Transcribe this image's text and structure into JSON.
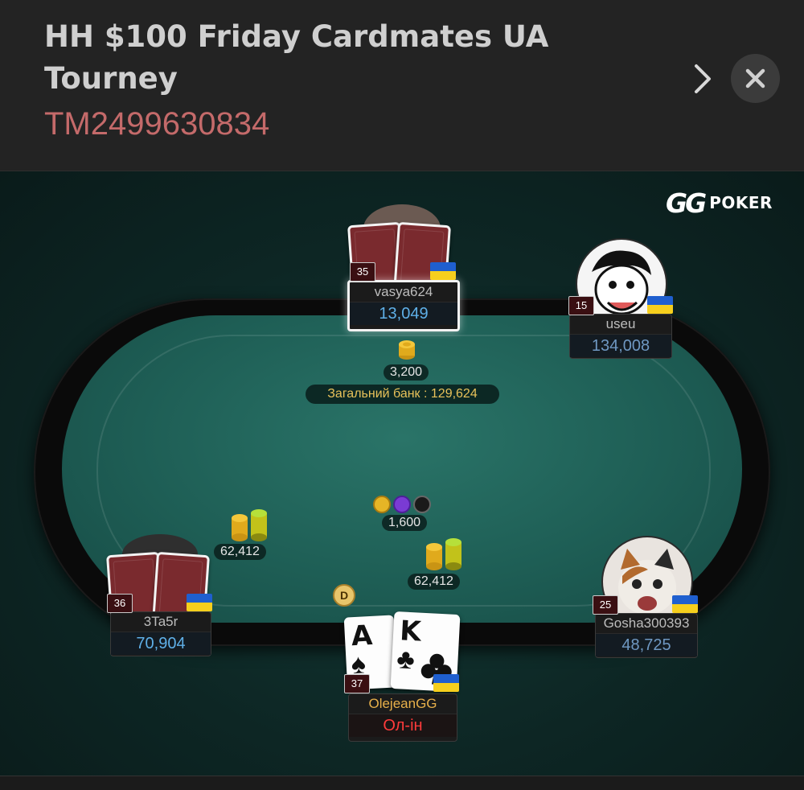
{
  "header": {
    "title": "HH $100 Friday Cardmates UA Tourney",
    "tournament_id": "TM2499630834",
    "next_icon": "chevron-right-icon",
    "close_icon": "close-icon"
  },
  "logo": {
    "brand_gg": "GG",
    "brand_text": "POKER"
  },
  "pot": {
    "bet_top": "3,200",
    "total_label": "Загальний банк : 129,624",
    "center_bet": "1,600",
    "bet_left": "62,412",
    "bet_right": "62,412"
  },
  "dealer_button": "D",
  "players": {
    "top": {
      "seat": "35",
      "name": "vasya624",
      "stack": "13,049"
    },
    "top_right": {
      "seat": "15",
      "name": "useu",
      "stack": "134,008"
    },
    "left": {
      "seat": "36",
      "name": "3Ta5r",
      "stack": "70,904"
    },
    "right": {
      "seat": "25",
      "name": "Gosha300393",
      "stack": "48,725"
    },
    "hero": {
      "seat": "37",
      "name": "OlejeanGG",
      "status": "Ол-ін",
      "card1_rank": "A",
      "card1_suit": "♠",
      "card2_rank": "K",
      "card2_suit": "♣"
    }
  },
  "colors": {
    "felt": "#1e5e55",
    "stack_blue": "#5fb0e8",
    "allin_red": "#ff3b3b",
    "pot_gold": "#e8c25a",
    "id_red": "#c46a6a"
  }
}
